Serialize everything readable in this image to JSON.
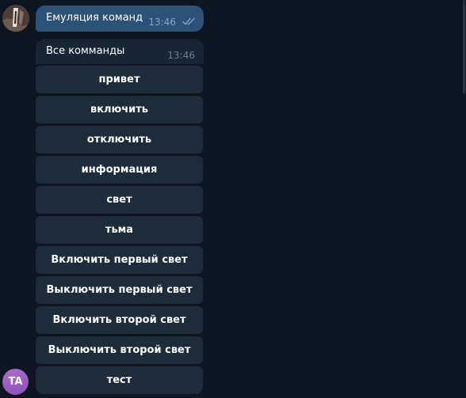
{
  "outgoing": {
    "text": "Емуляция команд",
    "time": "13:46",
    "status_icon": "double-check-icon"
  },
  "incoming": {
    "text": "Все комманды",
    "time": "13:46"
  },
  "keyboard": [
    {
      "label": "привет"
    },
    {
      "label": "включить"
    },
    {
      "label": "отключить"
    },
    {
      "label": "информация"
    },
    {
      "label": "свет"
    },
    {
      "label": "тьма"
    },
    {
      "label": "Включить первый свет"
    },
    {
      "label": "Выключить первый свет"
    },
    {
      "label": "Включить второй свет"
    },
    {
      "label": "Выключить второй свет"
    },
    {
      "label": "тест"
    }
  ],
  "bot_avatar": {
    "initials": "TA",
    "color": "#9b5cc4"
  },
  "colors": {
    "background": "#0e1621",
    "outgoing_bubble": "#2b5278",
    "incoming_bubble": "#182533",
    "keyboard_button": "#1e2c3a"
  }
}
